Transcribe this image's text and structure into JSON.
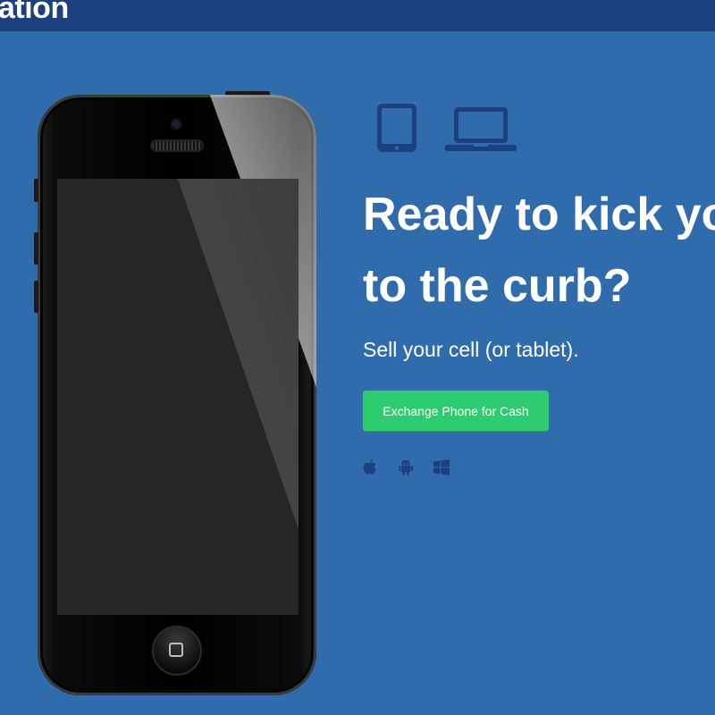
{
  "header": {
    "brand_fragment": "ation"
  },
  "hero": {
    "headline_line1": "Ready to kick yo",
    "headline_line2": "to the curb?",
    "subtitle": "Sell your cell (or tablet).",
    "cta_label": "Exchange Phone for Cash",
    "device_icons": [
      "tablet-icon",
      "laptop-icon"
    ],
    "os_icons": [
      "apple-icon",
      "android-icon",
      "windows-icon"
    ]
  },
  "colors": {
    "background": "#306bab",
    "topbar": "#1c3f7d",
    "icon": "#1c3f7d",
    "cta": "#2ecc71",
    "text": "#ffffff"
  }
}
